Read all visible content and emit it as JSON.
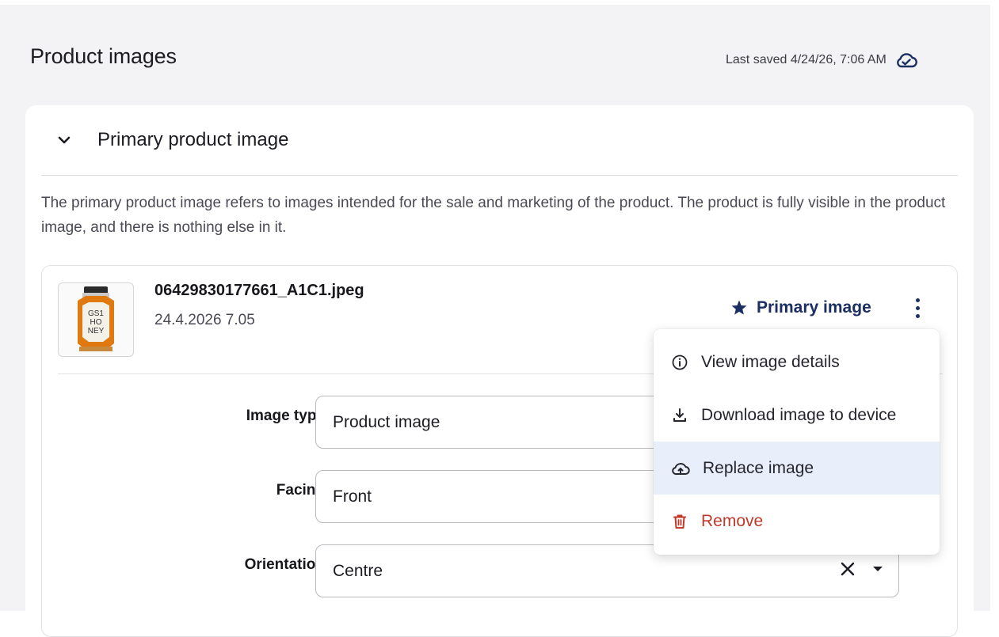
{
  "page": {
    "title": "Product images",
    "last_saved": "Last saved 4/24/26, 7:06 AM"
  },
  "section": {
    "title": "Primary product image",
    "description": "The primary product image refers to images intended for the sale and marketing of the product. The product is fully visible in the product image, and there is nothing else in it."
  },
  "image": {
    "file_name": "06429830177661_A1C1.jpeg",
    "date": "24.4.2026 7.05",
    "primary_label": "Primary image",
    "thumbnail_text": [
      "GS1",
      "HO",
      "NEY"
    ]
  },
  "fields": [
    {
      "label": "Image type",
      "value": "Product image"
    },
    {
      "label": "Facing",
      "value": "Front"
    },
    {
      "label": "Orientation",
      "value": "Centre"
    }
  ],
  "menu": {
    "items": [
      {
        "label": "View image details",
        "icon": "info-icon"
      },
      {
        "label": "Download image to device",
        "icon": "download-icon"
      },
      {
        "label": "Replace image",
        "icon": "cloud-upload-icon"
      },
      {
        "label": "Remove",
        "icon": "trash-icon"
      }
    ]
  },
  "colors": {
    "accent": "#1b2f63",
    "danger": "#c0392b",
    "menu_highlight": "#e8eefa",
    "page_background": "#f3f3f5"
  }
}
